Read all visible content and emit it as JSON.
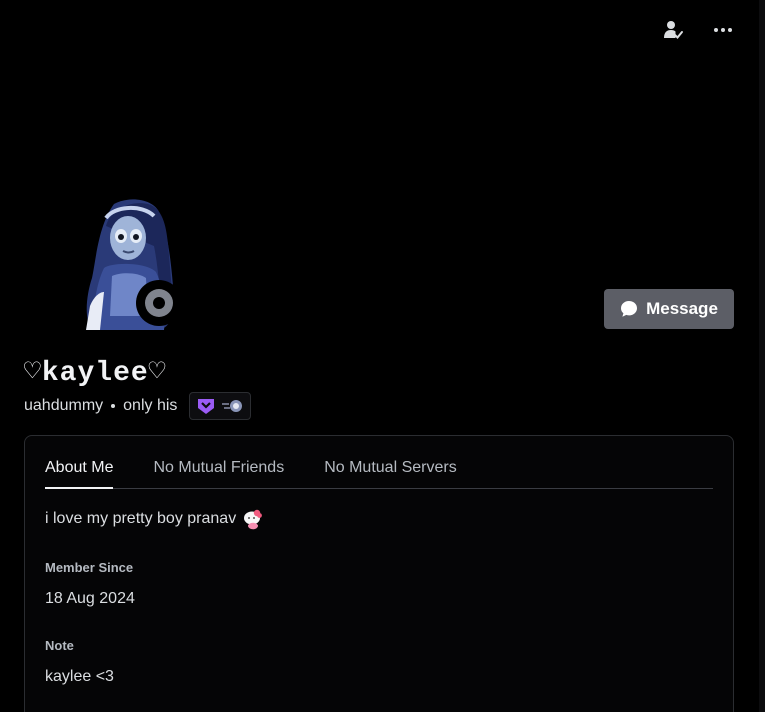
{
  "header": {
    "actions": [
      {
        "icon": "person-check-icon"
      },
      {
        "icon": "more-options-icon"
      }
    ]
  },
  "profile": {
    "display_name": "♡kaylee♡",
    "username": "uahdummy",
    "pronouns": "only his",
    "status": "offline",
    "badges": [
      {
        "icon": "hypesquad-balance-badge-icon"
      },
      {
        "icon": "quest-badge-icon"
      }
    ]
  },
  "message_button": {
    "label": "Message"
  },
  "tabs": [
    {
      "label": "About Me",
      "active": true
    },
    {
      "label": "No Mutual Friends",
      "active": false
    },
    {
      "label": "No Mutual Servers",
      "active": false
    }
  ],
  "about": {
    "bio": "i love my pretty boy pranav",
    "member_since_label": "Member Since",
    "member_since_value": "18 Aug 2024",
    "note_label": "Note",
    "note_value": "kaylee <3"
  },
  "colors": {
    "background": "#000000",
    "button": "#5c5e66",
    "status_offline": "#80848e",
    "badge_purple": "#9b5cf5"
  }
}
